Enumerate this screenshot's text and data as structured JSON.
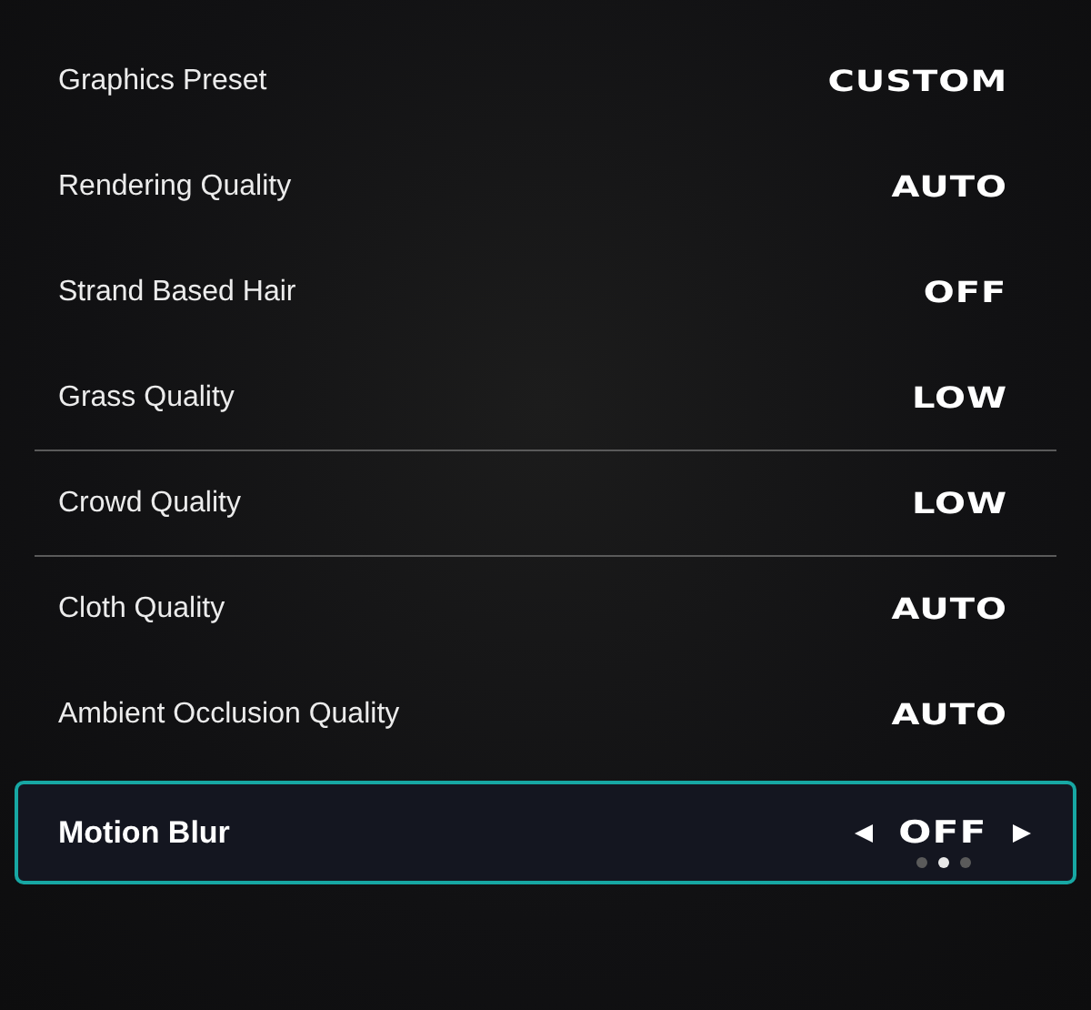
{
  "settings": [
    {
      "label": "Graphics Preset",
      "value": "CUSTOM",
      "focused": false,
      "divider_below": false
    },
    {
      "label": "Rendering Quality",
      "value": "AUTO",
      "focused": false,
      "divider_below": false
    },
    {
      "label": "Strand Based Hair",
      "value": "OFF",
      "focused": false,
      "divider_below": false
    },
    {
      "label": "Grass Quality",
      "value": "LOW",
      "focused": false,
      "divider_below": true
    },
    {
      "label": "Crowd Quality",
      "value": "LOW",
      "focused": false,
      "divider_below": true
    },
    {
      "label": "Cloth Quality",
      "value": "AUTO",
      "focused": false,
      "divider_below": false
    },
    {
      "label": "Ambient Occlusion Quality",
      "value": "AUTO",
      "focused": false,
      "divider_below": false
    },
    {
      "label": "Motion Blur",
      "value": "OFF",
      "focused": true,
      "options": [
        {
          "selected": false
        },
        {
          "selected": true
        },
        {
          "selected": false
        }
      ]
    }
  ]
}
